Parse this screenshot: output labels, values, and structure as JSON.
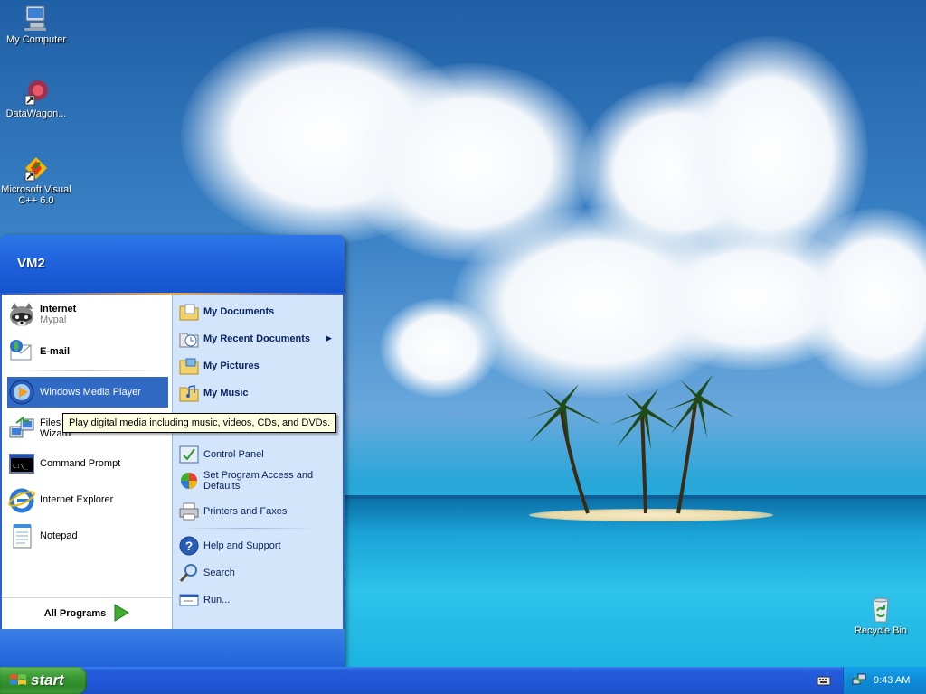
{
  "desktop": {
    "icons": [
      {
        "label": "My Computer",
        "icon": "my-computer-icon"
      },
      {
        "label": "DataWagon...",
        "icon": "datawagon-icon"
      },
      {
        "label": "Microsoft Visual C++ 6.0",
        "icon": "visual-cpp-icon"
      },
      {
        "label": "Recycle Bin",
        "icon": "recycle-bin-icon"
      }
    ]
  },
  "start_menu": {
    "user_name": "VM2",
    "left_items": [
      {
        "label": "Internet",
        "sublabel": "Mypal",
        "icon": "raccoon-browser-icon",
        "bold": true
      },
      {
        "label": "E-mail",
        "icon": "email-icon",
        "bold": true
      },
      {
        "label": "Windows Media Player",
        "icon": "media-player-icon",
        "highlighted": true
      },
      {
        "label": "Files and Settings Transfer Wizard",
        "label_line1": "Files",
        "label_line2": "Wizard",
        "icon": "transfer-wizard-icon"
      },
      {
        "label": "Command Prompt",
        "icon": "command-prompt-icon"
      },
      {
        "label": "Internet Explorer",
        "icon": "internet-explorer-icon"
      },
      {
        "label": "Notepad",
        "icon": "notepad-icon"
      }
    ],
    "all_programs": "All Programs",
    "right_items": [
      {
        "label": "My Documents",
        "icon": "folder-documents-icon",
        "bold": true
      },
      {
        "label": "My Recent Documents",
        "icon": "recent-documents-icon",
        "bold": true,
        "submenu": true
      },
      {
        "label": "My Pictures",
        "icon": "folder-pictures-icon",
        "bold": true
      },
      {
        "label": "My Music",
        "icon": "folder-music-icon",
        "bold": true
      },
      {
        "label": "Control Panel",
        "icon": "control-panel-icon"
      },
      {
        "label": "Set Program Access and Defaults",
        "label_line1": "Set Program Access and",
        "label_line2": "Defaults",
        "icon": "program-access-icon"
      },
      {
        "label": "Printers and Faxes",
        "icon": "printer-icon"
      },
      {
        "label": "Help and Support",
        "icon": "help-icon"
      },
      {
        "label": "Search",
        "icon": "search-icon"
      },
      {
        "label": "Run...",
        "icon": "run-icon"
      }
    ],
    "tooltip": "Play digital media including music, videos, CDs, and DVDs."
  },
  "taskbar": {
    "start_label": "start",
    "clock": "9:43 AM"
  },
  "colors": {
    "taskbar_blue": "#245edb",
    "start_green": "#3c9b35",
    "highlight": "#316ac5",
    "right_pane": "#d3e5fa"
  }
}
